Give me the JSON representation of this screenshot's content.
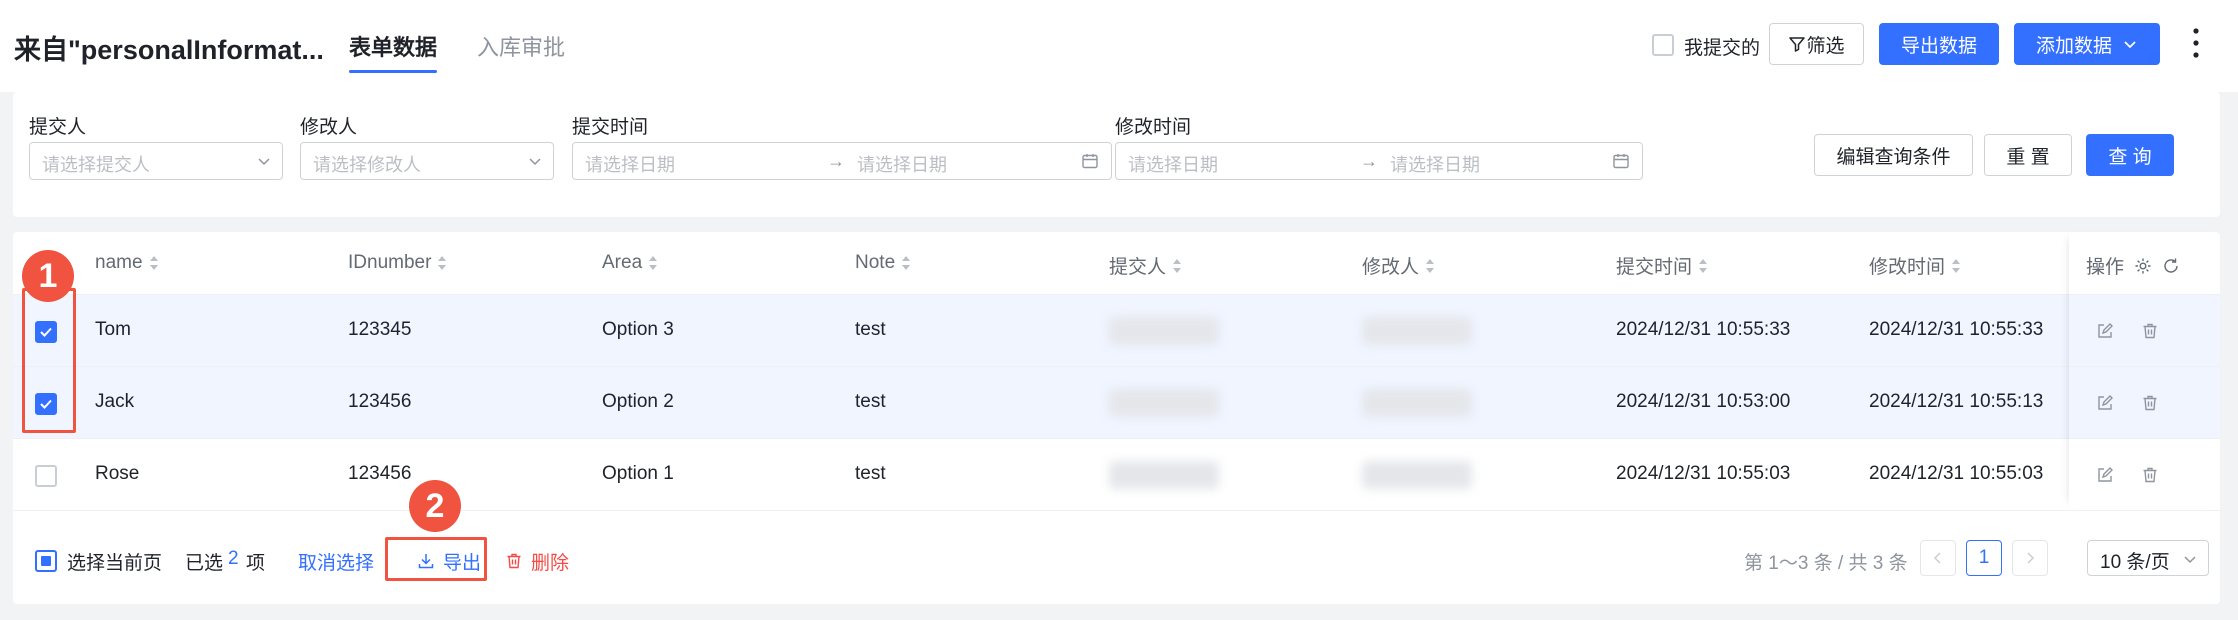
{
  "header": {
    "title": "来自\"personalInformat...",
    "tabs": [
      {
        "label": "表单数据",
        "active": true
      },
      {
        "label": "入库审批",
        "active": false
      }
    ],
    "mine_label": "我提交的",
    "filter_label": "筛选",
    "export_label": "导出数据",
    "add_label": "添加数据"
  },
  "filters": {
    "submitter": {
      "label": "提交人",
      "placeholder": "请选择提交人"
    },
    "modifier": {
      "label": "修改人",
      "placeholder": "请选择修改人"
    },
    "submit_time": {
      "label": "提交时间",
      "start": "请选择日期",
      "arrow": "→",
      "end": "请选择日期"
    },
    "modify_time": {
      "label": "修改时间",
      "start": "请选择日期",
      "arrow": "→",
      "end": "请选择日期"
    },
    "edit_query_label": "编辑查询条件",
    "reset_label": "重 置",
    "query_label": "查 询"
  },
  "table": {
    "columns": [
      "name",
      "IDnumber",
      "Area",
      "Note",
      "提交人",
      "修改人",
      "提交时间",
      "修改时间"
    ],
    "ops_label": "操作",
    "rows": [
      {
        "selected": true,
        "name": "Tom",
        "id": "123345",
        "area": "Option 3",
        "note": "test",
        "submit_time": "2024/12/31 10:55:33",
        "modify_time": "2024/12/31 10:55:33"
      },
      {
        "selected": true,
        "name": "Jack",
        "id": "123456",
        "area": "Option 2",
        "note": "test",
        "submit_time": "2024/12/31 10:53:00",
        "modify_time": "2024/12/31 10:55:13"
      },
      {
        "selected": false,
        "name": "Rose",
        "id": "123456",
        "area": "Option 1",
        "note": "test",
        "submit_time": "2024/12/31 10:55:03",
        "modify_time": "2024/12/31 10:55:03"
      }
    ]
  },
  "footer": {
    "select_page_label": "选择当前页",
    "selected_prefix": "已选",
    "selected_count": "2",
    "selected_suffix": "项",
    "cancel_label": "取消选择",
    "export_label": "导出",
    "delete_label": "删除",
    "range_text": "第 1～3 条 / 共 3 条",
    "current_page": "1",
    "page_size": "10 条/页"
  },
  "annotations": {
    "badge1": "1",
    "badge2": "2"
  },
  "colors": {
    "primary": "#3370ff",
    "danger": "#f54a45",
    "annotation": "#f0533f"
  }
}
